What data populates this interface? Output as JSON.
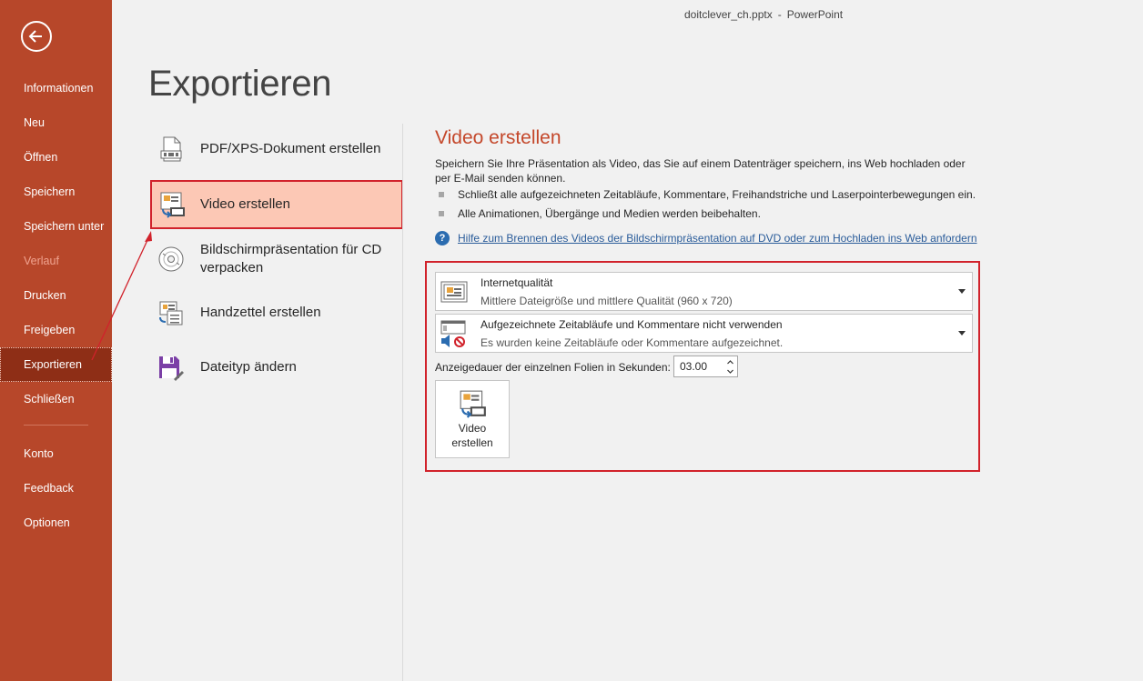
{
  "window": {
    "filename": "doitclever_ch.pptx",
    "separator": "-",
    "app": "PowerPoint"
  },
  "sidebar": {
    "back_icon": "back-arrow-icon",
    "items": [
      {
        "label": "Informationen"
      },
      {
        "label": "Neu"
      },
      {
        "label": "Öffnen"
      },
      {
        "label": "Speichern"
      },
      {
        "label": "Speichern unter"
      },
      {
        "label": "Verlauf",
        "disabled": true
      },
      {
        "label": "Drucken"
      },
      {
        "label": "Freigeben"
      },
      {
        "label": "Exportieren",
        "active": true
      },
      {
        "label": "Schließen"
      },
      {
        "label": "Konto"
      },
      {
        "label": "Feedback"
      },
      {
        "label": "Optionen"
      }
    ]
  },
  "page": {
    "title": "Exportieren"
  },
  "export_options": [
    {
      "label": "PDF/XPS-Dokument erstellen",
      "icon": "pdf-document-icon"
    },
    {
      "label": "Video erstellen",
      "icon": "video-export-icon",
      "selected": true
    },
    {
      "label": "Bildschirmpräsentation für CD verpacken",
      "icon": "cd-package-icon"
    },
    {
      "label": "Handzettel erstellen",
      "icon": "handout-icon"
    },
    {
      "label": "Dateityp ändern",
      "icon": "change-filetype-icon"
    }
  ],
  "video": {
    "title": "Video erstellen",
    "description": "Speichern Sie Ihre Präsentation als Video, das Sie auf einem Datenträger speichern, ins Web hochladen oder per E-Mail senden können.",
    "bullets": [
      "Schließt alle aufgezeichneten Zeitabläufe, Kommentare, Freihandstriche und Laserpointerbewegungen ein.",
      "Alle Animationen, Übergänge und Medien werden beibehalten."
    ],
    "help_link": "Hilfe zum Brennen des Videos der Bildschirmpräsentation auf DVD oder zum Hochladen ins Web anfordern",
    "quality": {
      "main": "Internetqualität",
      "sub": "Mittlere Dateigröße und mittlere Qualität (960 x 720)"
    },
    "timings": {
      "main": "Aufgezeichnete Zeitabläufe und Kommentare nicht verwenden",
      "sub": "Es wurden keine Zeitabläufe oder Kommentare aufgezeichnet."
    },
    "duration_label": "Anzeigedauer der einzelnen Folien in Sekunden:",
    "duration_value": "03.00",
    "create_button_line1": "Video",
    "create_button_line2": "erstellen"
  },
  "colors": {
    "sidebar": "#b7472a",
    "sidebar_active": "#8e2e16",
    "accent_title": "#c4472a",
    "highlight_fill": "#fcc8b5",
    "annotation_red": "#d1222b",
    "link": "#2a5c9a"
  }
}
